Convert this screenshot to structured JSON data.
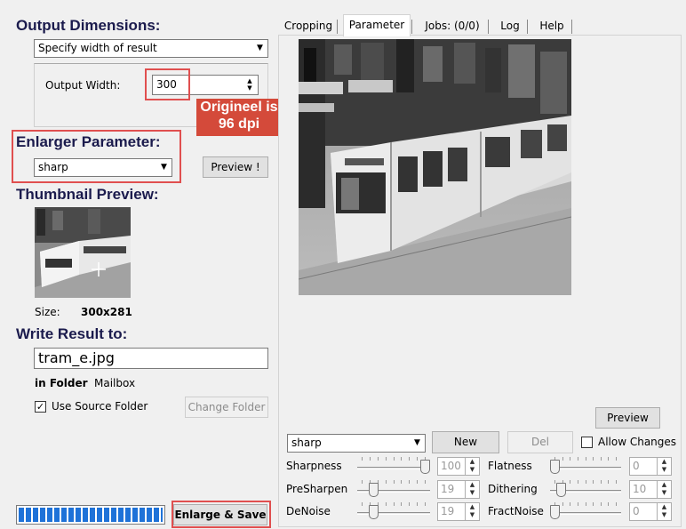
{
  "left": {
    "output_dimensions_heading": "Output Dimensions:",
    "dimension_mode": "Specify width of result",
    "output_width_label": "Output Width:",
    "output_width_value": "300",
    "annotation": "Origineel is 96 dpi",
    "enlarger_heading": "Enlarger Parameter:",
    "enlarger_preset": "sharp",
    "preview_button": "Preview !",
    "thumbnail_heading": "Thumbnail Preview:",
    "size_label": "Size:",
    "size_value": "300x281",
    "write_heading": "Write Result to:",
    "filename": "tram_e.jpg",
    "in_folder_label": "in Folder",
    "folder_name": "Mailbox",
    "use_source_label": "Use Source Folder",
    "use_source_checked": true,
    "change_folder_button": "Change Folder",
    "progress": 1.0,
    "enlarge_save_button": "Enlarge & Save"
  },
  "tabs": [
    "Cropping",
    "Parameter",
    "Jobs: (0/0)",
    "Log",
    "Help"
  ],
  "active_tab": "Parameter",
  "params": {
    "preview_button": "Preview",
    "preset": "sharp",
    "new_button": "New",
    "del_button": "Del",
    "allow_changes_label": "Allow Changes",
    "allow_changes_checked": false,
    "sliders": [
      {
        "label": "Sharpness",
        "value": "100",
        "level": 1.0
      },
      {
        "label": "PreSharpen",
        "value": "19",
        "level": 0.19
      },
      {
        "label": "DeNoise",
        "value": "19",
        "level": 0.19
      },
      {
        "label": "Flatness",
        "value": "0",
        "level": 0.0
      },
      {
        "label": "Dithering",
        "value": "10",
        "level": 0.1
      },
      {
        "label": "FractNoise",
        "value": "0",
        "level": 0.0
      }
    ]
  },
  "colors": {
    "accent_red": "#e04f4f",
    "annotation_bg": "#c0392b",
    "progress": "#1e72d8",
    "heading": "#1b1b4d"
  },
  "icons": {
    "combo_arrow": "chevron-down-icon",
    "spin_arrows": "spinner-arrows-icon",
    "checkbox": "checkbox-icon"
  }
}
